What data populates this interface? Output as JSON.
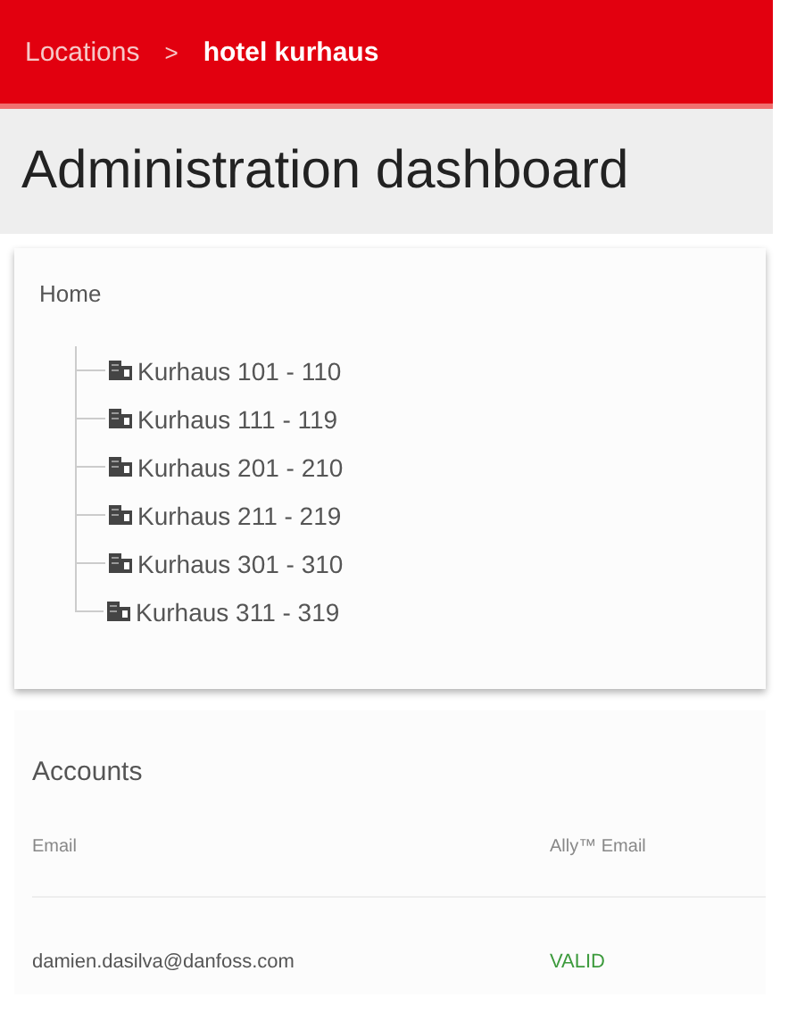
{
  "breadcrumb": [
    {
      "label": "Locations",
      "current": false
    },
    {
      "label": ">",
      "kind": "separator"
    },
    {
      "label": "hotel kurhaus",
      "current": true
    }
  ],
  "page_title": "Administration dashboard",
  "tree": {
    "label": "Home",
    "children": [
      {
        "label": "Kurhaus 101 - 110"
      },
      {
        "label": "Kurhaus 111 - 119"
      },
      {
        "label": "Kurhaus 201 - 210"
      },
      {
        "label": "Kurhaus 211 - 219"
      },
      {
        "label": "Kurhaus 301 - 310"
      },
      {
        "label": "Kurhaus 311 - 319"
      }
    ]
  },
  "accounts": {
    "title": "Accounts",
    "columns": [
      "Email",
      "Ally™ Email"
    ],
    "rows": [
      {
        "email": "damien.dasilva@danfoss.com",
        "status": "VALID"
      }
    ]
  }
}
